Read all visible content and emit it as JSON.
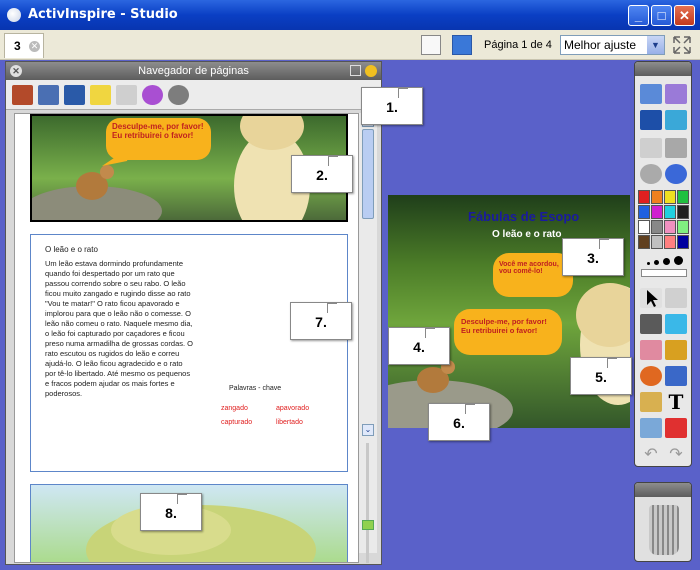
{
  "window": {
    "title": "ActivInspire - Studio"
  },
  "toolbar": {
    "tab_number": "3",
    "page_label": "Página 1 de 4",
    "zoom_value": "Melhor ajuste"
  },
  "navigator": {
    "title": "Navegador de páginas",
    "page1_speech": "Desculpe-me, por favor! Eu retribuirei o favor!",
    "page2": {
      "title": "O leão e o rato",
      "paragraph": "Um leão estava dormindo profundamente quando foi despertado por um rato que passou correndo sobre o seu rabo. O leão ficou muito zangado e rugindo disse ao rato \"Vou te matar!\" O rato ficou apavorado e implorou para que o leão não o comesse. O leão não comeu o rato. Naquele mesmo dia, o leão foi capturado por caçadores e ficou preso numa armadilha de grossas cordas. O rato escutou os rugidos do leão e correu ajudá-lo. O leão ficou agradecido e o rato por tê-lo libertado. Até mesmo os pequenos e fracos podem ajudar os mais fortes e poderosos.",
      "keywords_title": "Palavras - chave",
      "keywords": [
        "zangado",
        "apavorado",
        "capturado",
        "libertado"
      ]
    }
  },
  "canvas": {
    "title": "Fábulas de Esopo",
    "subtitle": "O leão e o rato",
    "lion_speech": "Você me acordou, vou comê-lo!",
    "mouse_speech": "Desculpe-me, por favor! Eu retribuirei o favor!"
  },
  "callouts": [
    "1.",
    "2.",
    "3.",
    "4.",
    "5.",
    "6.",
    "7.",
    "8."
  ],
  "palette": [
    "#e02020",
    "#f08020",
    "#f0e020",
    "#20c040",
    "#2060e0",
    "#d020d0",
    "#20d0e0",
    "#202020",
    "#ffffff",
    "#888888",
    "#f090c0",
    "#80f080",
    "#604020",
    "#c0c0c0",
    "#ff8080",
    "#0000a0"
  ]
}
